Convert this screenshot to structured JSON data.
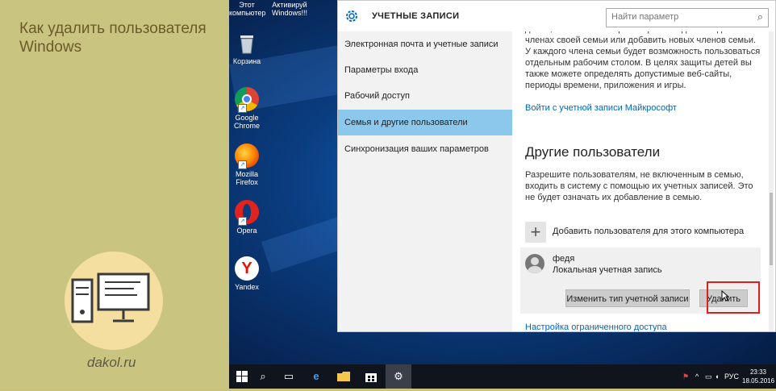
{
  "article": {
    "title": "Как удалить пользователя Windows",
    "site": "dakol.ru"
  },
  "desktop": {
    "top_labels": {
      "computer": "Этот компьютер",
      "activate": "Активируй Windows!!!"
    },
    "icons": [
      {
        "label": "Корзина",
        "icon": "recycle-bin-icon"
      },
      {
        "label": "Google Chrome",
        "icon": "chrome-icon"
      },
      {
        "label": "Mozilla Firefox",
        "icon": "firefox-icon"
      },
      {
        "label": "Opera",
        "icon": "opera-icon"
      },
      {
        "label": "Yandex",
        "icon": "yandex-icon"
      }
    ]
  },
  "settings": {
    "title": "УЧЕТНЫЕ ЗАПИСИ",
    "search_placeholder": "Найти параметр",
    "nav": [
      {
        "label": "Электронная почта и учетные записи",
        "active": false
      },
      {
        "label": "Параметры входа",
        "active": false
      },
      {
        "label": "Рабочий доступ",
        "active": false
      },
      {
        "label": "Семья и другие пользователи",
        "active": true
      },
      {
        "label": "Синхронизация ваших параметров",
        "active": false
      }
    ],
    "content": {
      "family_text": "детям, позволив вам просматривать здесь сведения о членах своей семьи или добавить новых членов семьи. У каждого члена семьи будет возможность пользоваться отдельным рабочим столом. В целях защиты детей вы также можете определять допустимые веб-сайты, периоды времени, приложения и игры.",
      "ms_link": "Войти с учетной записи Майкрософт",
      "other_heading": "Другие пользователи",
      "other_text": "Разрешите пользователям, не включенным в семью, входить в систему с помощью их учетных записей. Это не будет означать их добавление в семью.",
      "add_user": "Добавить пользователя для этого компьютера",
      "user": {
        "name": "федя",
        "type": "Локальная учетная запись"
      },
      "change_type_button": "Изменить тип учетной записи",
      "delete_button": "Удалить",
      "restricted_link": "Настройка ограниченного доступа"
    }
  },
  "taskbar": {
    "language": "РУС",
    "time": "23:33",
    "date": "18.05.2016"
  },
  "colors": {
    "accent": "#0067b8",
    "nav_active": "#8cc8ec",
    "highlight": "#e01e1e",
    "left_panel": "#c9c47f"
  }
}
